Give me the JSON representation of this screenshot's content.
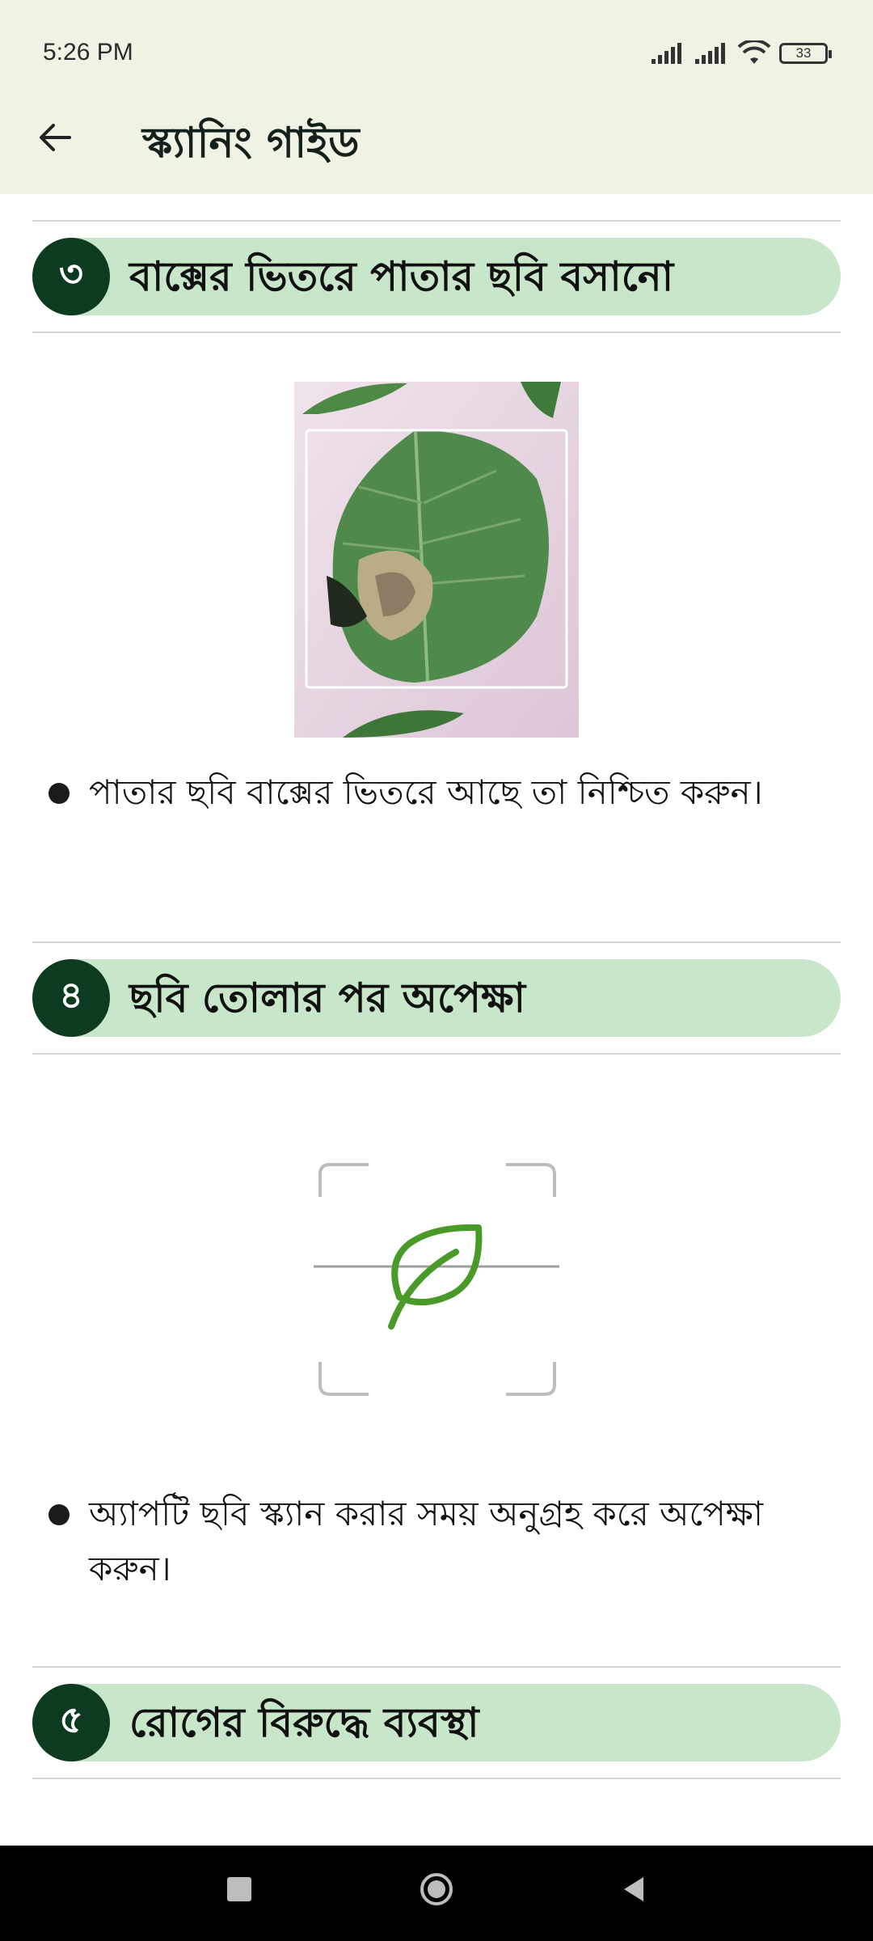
{
  "status": {
    "time": "5:26 PM",
    "battery": "33"
  },
  "appbar": {
    "title": "স্ক্যানিং গাইড",
    "back_icon": "arrow-left-icon"
  },
  "sections": [
    {
      "number": "৩",
      "title": "বাক্সের ভিতরে পাতার ছবি বসানো",
      "bullet": "পাতার ছবি বাক্সের ভিতরে আছে তা নিশ্চিত করুন।"
    },
    {
      "number": "৪",
      "title": "ছবি তোলার পর অপেক্ষা",
      "bullet": "অ্যাপটি ছবি স্ক্যান করার সময় অনুগ্রহ করে অপেক্ষা করুন।"
    },
    {
      "number": "৫",
      "title": "রোগের বিরুদ্ধে ব্যবস্থা"
    }
  ],
  "colors": {
    "header_bg": "#eef3e3",
    "section_pill": "#c8e6c9",
    "badge": "#0d3b20",
    "leaf_icon": "#4a9a2a"
  }
}
